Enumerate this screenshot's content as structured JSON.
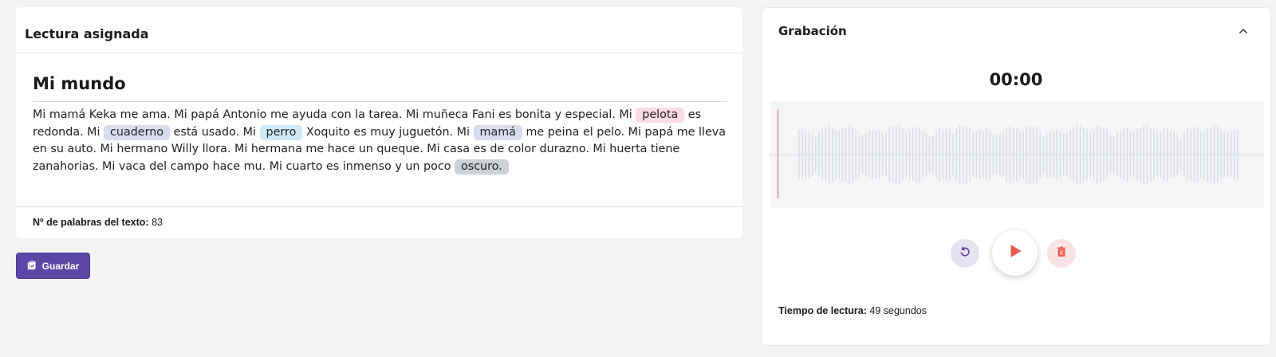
{
  "assigned_reading": {
    "header": "Lectura asignada",
    "title": "Mi mundo",
    "segments": [
      {
        "text": "Mi mamá Keka me ama. Mi papá Antonio me ayuda con la tarea. Mi muñeca Fani es bonita y especial. Mi "
      },
      {
        "text": "pelota",
        "highlight": "#fbdbe7"
      },
      {
        "text": " es redonda. Mi "
      },
      {
        "text": "cuaderno",
        "highlight": "#d8dcee"
      },
      {
        "text": " está usado. Mi "
      },
      {
        "text": "perro",
        "highlight": "#cfe8f8"
      },
      {
        "text": " Xoquito es muy juguetón. Mi "
      },
      {
        "text": "mamá",
        "highlight": "#d8dcee"
      },
      {
        "text": " me peina el pelo. Mi papá me lleva en su auto. Mi hermano Willy llora. Mi hermana me hace un queque. Mi casa es de color durazno. Mi huerta tiene zanahorias. Mi vaca del campo hace mu. Mi cuarto es inmenso y un poco "
      },
      {
        "text": "oscuro.",
        "highlight": "#cdd1d6"
      }
    ],
    "word_count_label": "Nº de palabras del texto:",
    "word_count": "83"
  },
  "save_button": {
    "label": "Guardar",
    "icon": "save-clipboard-icon",
    "color": "#5c47a6"
  },
  "recording": {
    "header": "Grabación",
    "timer": "00:00",
    "playhead_color": "#e57373",
    "controls": {
      "restart_icon": "restart-icon",
      "play_icon": "play-icon",
      "delete_icon": "trash-icon",
      "accent": "#e85a4f"
    },
    "reading_time_label": "Tiempo de lectura:",
    "reading_time_value": "49 segundos"
  }
}
